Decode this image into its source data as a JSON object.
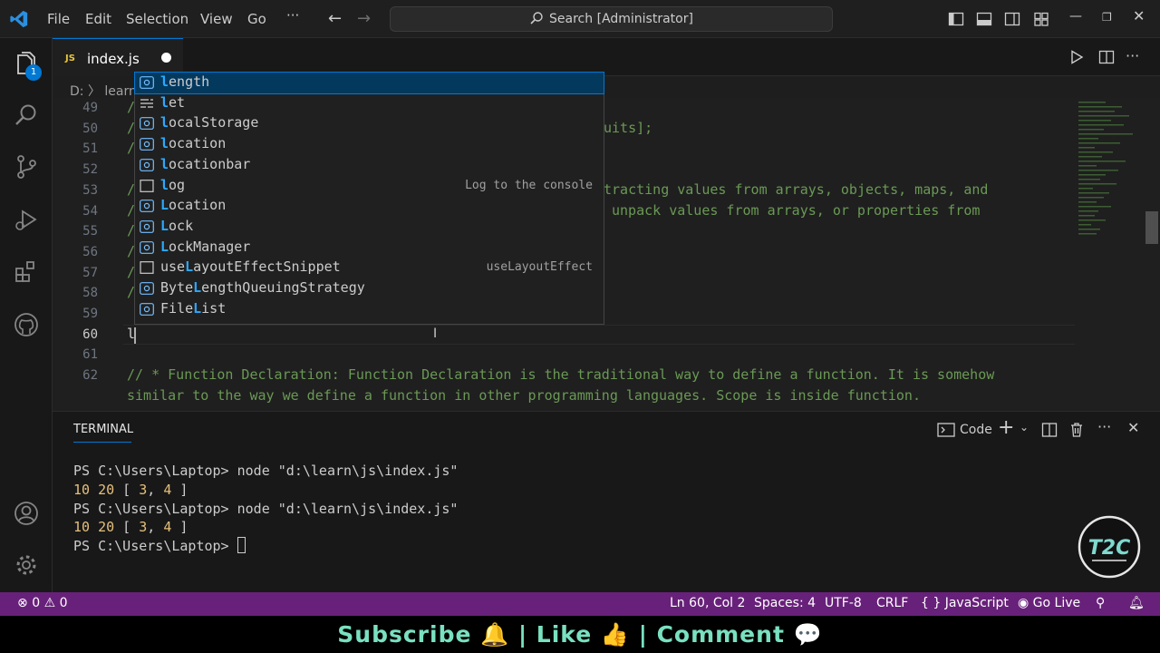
{
  "menu": [
    "File",
    "Edit",
    "Selection",
    "View",
    "Go",
    "···"
  ],
  "search": {
    "label": "Search [Administrator]"
  },
  "activity": {
    "explorer_badge": "1"
  },
  "tab": {
    "js_badge": "JS",
    "filename": "index.js"
  },
  "breadcrumb": "D: 〉 learn",
  "editor": {
    "lines": [
      {
        "n": "49",
        "text": "/"
      },
      {
        "n": "50",
        "text": "/",
        "tail": "uits];"
      },
      {
        "n": "51",
        "text": "/"
      },
      {
        "n": "52",
        "text": ""
      },
      {
        "n": "53",
        "text": "/",
        "tail": "tracting values from arrays, objects, maps, and"
      },
      {
        "n": "54",
        "text": "/",
        "tail": "unpack values from arrays, or properties from"
      },
      {
        "n": "55",
        "text": "/"
      },
      {
        "n": "56",
        "text": "/"
      },
      {
        "n": "57",
        "text": "/"
      },
      {
        "n": "58",
        "text": "/"
      },
      {
        "n": "59",
        "text": ""
      },
      {
        "n": "60",
        "text": "l"
      },
      {
        "n": "61",
        "text": ""
      },
      {
        "n": "62",
        "text": "// * Function Declaration: Function Declaration is the traditional way to define a function. It is somehow"
      },
      {
        "n": "",
        "text": "similar to the way we define a function in other programming languages. Scope is inside function."
      }
    ]
  },
  "suggest": [
    {
      "pre": "",
      "hl": "l",
      "post": "ength",
      "kind": "var",
      "detail": ""
    },
    {
      "pre": "",
      "hl": "l",
      "post": "et",
      "kind": "keyword",
      "detail": ""
    },
    {
      "pre": "",
      "hl": "l",
      "post": "ocalStorage",
      "kind": "var",
      "detail": ""
    },
    {
      "pre": "",
      "hl": "l",
      "post": "ocation",
      "kind": "var",
      "detail": ""
    },
    {
      "pre": "",
      "hl": "l",
      "post": "ocationbar",
      "kind": "var",
      "detail": ""
    },
    {
      "pre": "",
      "hl": "l",
      "post": "og",
      "kind": "snippet",
      "detail": "Log to the console"
    },
    {
      "pre": "",
      "hl": "L",
      "post": "ocation",
      "kind": "var",
      "detail": ""
    },
    {
      "pre": "",
      "hl": "L",
      "post": "ock",
      "kind": "var",
      "detail": ""
    },
    {
      "pre": "",
      "hl": "L",
      "post": "ockManager",
      "kind": "var",
      "detail": ""
    },
    {
      "pre": "use",
      "hl": "L",
      "post": "ayoutEffectSnippet",
      "kind": "snippet",
      "detail": "useLayoutEffect"
    },
    {
      "pre": "Byte",
      "hl": "L",
      "post": "engthQueuingStrategy",
      "kind": "var",
      "detail": ""
    },
    {
      "pre": "File",
      "hl": "L",
      "post": "ist",
      "kind": "var",
      "detail": ""
    }
  ],
  "panel": {
    "tab": "TERMINAL",
    "profile": "Code",
    "terminal": [
      {
        "prompt": "PS C:\\Users\\Laptop> ",
        "cmd": "node \"d:\\learn\\js\\index.js\""
      },
      {
        "nums": "10 20",
        "rest": " [ ",
        "n1": "3",
        "sep": ", ",
        "n2": "4",
        "end": " ]"
      },
      {
        "prompt": "PS C:\\Users\\Laptop> ",
        "cmd": "node \"d:\\learn\\js\\index.js\""
      },
      {
        "nums": "10 20",
        "rest": " [ ",
        "n1": "3",
        "sep": ", ",
        "n2": "4",
        "end": " ]"
      },
      {
        "prompt": "PS C:\\Users\\Laptop> ",
        "cmd": ""
      }
    ],
    "logo_text": "T2C"
  },
  "status": {
    "errors": "0",
    "warnings": "0",
    "position": "Ln 60, Col 2",
    "spaces": "Spaces: 4",
    "encoding": "UTF-8",
    "eol": "CRLF",
    "language": "JavaScript",
    "golive": "Go Live"
  },
  "banner": "Subscribe 🔔 | Like 👍 | Comment 💬",
  "colors": {
    "statusbar": "#68217a",
    "accent": "#0078d4",
    "comment": "#6a9955",
    "highlight": "#2aaaff"
  }
}
